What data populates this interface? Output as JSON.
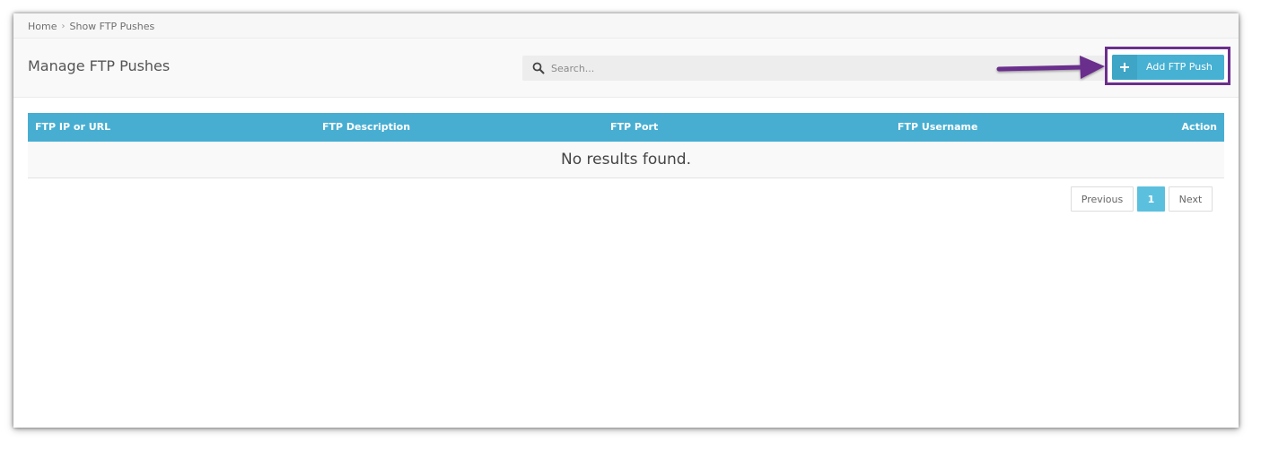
{
  "breadcrumb": {
    "home": "Home",
    "separator": "›",
    "current": "Show FTP Pushes"
  },
  "header": {
    "title": "Manage FTP Pushes",
    "search": {
      "placeholder": "Search...",
      "value": "",
      "icon": "search-icon"
    },
    "add_button": {
      "label": "Add FTP Push",
      "icon": "plus-icon"
    }
  },
  "annotation": {
    "arrow_color": "#6b2f8c",
    "highlight_color": "#6b2f8c"
  },
  "table": {
    "columns": [
      "FTP IP or URL",
      "FTP Description",
      "FTP Port",
      "FTP Username",
      "Action"
    ],
    "rows": [],
    "empty_message": "No results found.",
    "header_color": "#47aed2"
  },
  "pagination": {
    "previous": "Previous",
    "current_page": "1",
    "next": "Next"
  },
  "colors": {
    "accent": "#46b1d3",
    "page_active": "#5bc0de"
  }
}
